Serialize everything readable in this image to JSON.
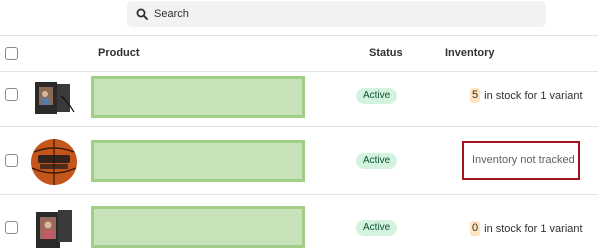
{
  "search": {
    "placeholder": "Search",
    "icon": "search-icon"
  },
  "table": {
    "headers": {
      "product": "Product",
      "status": "Status",
      "inventory": "Inventory"
    },
    "rows": [
      {
        "thumbnail": "photo-frame-black",
        "status": "Active",
        "inventory_qty": "5",
        "inventory_text": "in stock for 1 variant"
      },
      {
        "thumbnail": "basketball",
        "status": "Active",
        "inventory_text": "Inventory not tracked",
        "highlight_color": "#a3131c"
      },
      {
        "thumbnail": "photo-frame-black",
        "status": "Active",
        "inventory_qty": "0",
        "inventory_text": "in stock for 1 variant"
      }
    ]
  },
  "colors": {
    "badge_bg": "#d4f3df",
    "badge_text": "#0c5132",
    "qty_bg": "#ffe4bf",
    "placeholder_fill": "#c7e2b9",
    "placeholder_border": "#a1ce89"
  }
}
